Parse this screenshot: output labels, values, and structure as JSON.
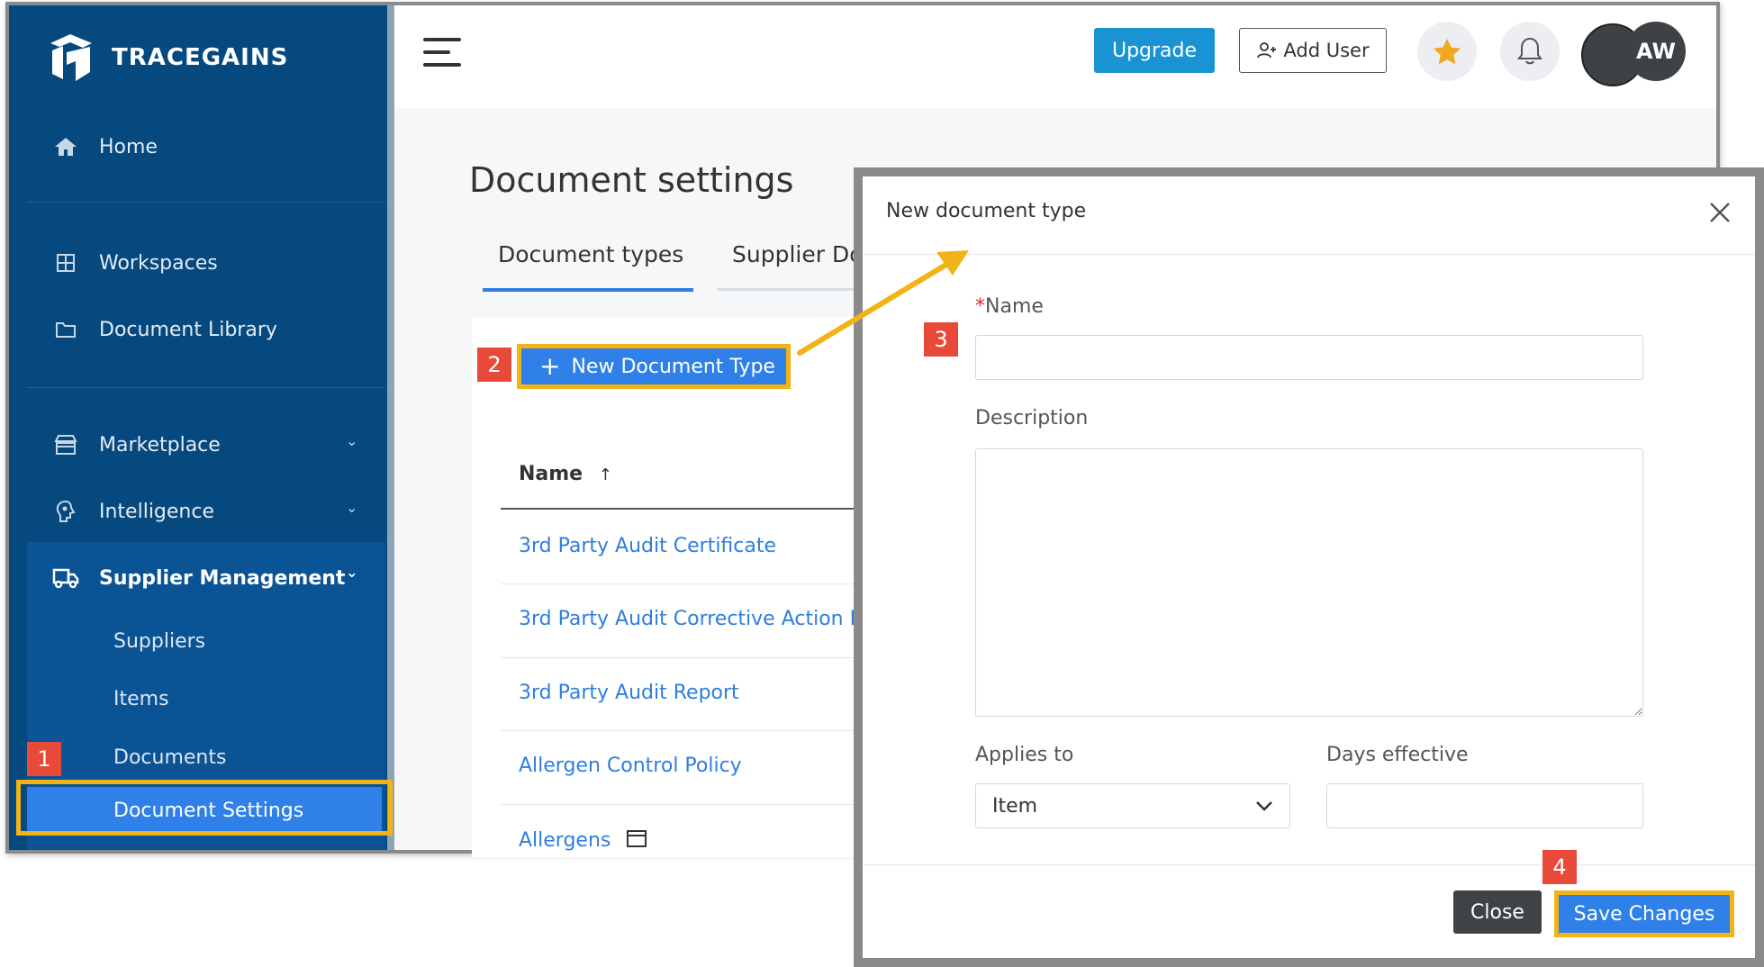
{
  "app": {
    "brand": "TRACEGAINS",
    "nav": {
      "home": "Home",
      "workspaces": "Workspaces",
      "document_library": "Document Library",
      "marketplace": "Marketplace",
      "intelligence": "Intelligence",
      "supplier_management": "Supplier Management",
      "sub_items": {
        "suppliers": "Suppliers",
        "items": "Items",
        "documents": "Documents",
        "document_settings": "Document Settings"
      }
    },
    "topbar": {
      "upgrade_label": "Upgrade",
      "add_user_label": "Add User",
      "avatar_initials": "AW"
    },
    "page": {
      "title": "Document settings",
      "tabs": [
        "Document types",
        "Supplier Do"
      ],
      "new_button_label": "New Document Type",
      "table": {
        "column_name": "Name",
        "sort_indicator": "↑",
        "rows": [
          "3rd Party Audit Certificate",
          "3rd Party Audit Corrective Action P",
          "3rd Party Audit Report",
          "Allergen Control Policy",
          "Allergens"
        ]
      }
    }
  },
  "modal": {
    "title": "New document type",
    "name_required_mark": "*",
    "name_label": "Name",
    "name_value": "",
    "description_label": "Description",
    "description_value": "",
    "applies_to_label": "Applies to",
    "applies_to_value": "Item",
    "days_effective_label": "Days effective",
    "days_effective_value": "",
    "close_label": "Close",
    "save_label": "Save Changes"
  },
  "callouts": [
    "1",
    "2",
    "3",
    "4"
  ],
  "colors": {
    "sidebar": "#05497f",
    "accent_blue": "#2f80e8",
    "highlight": "#f2b316",
    "callout": "#e84a3a",
    "upgrade": "#1a93d4"
  }
}
